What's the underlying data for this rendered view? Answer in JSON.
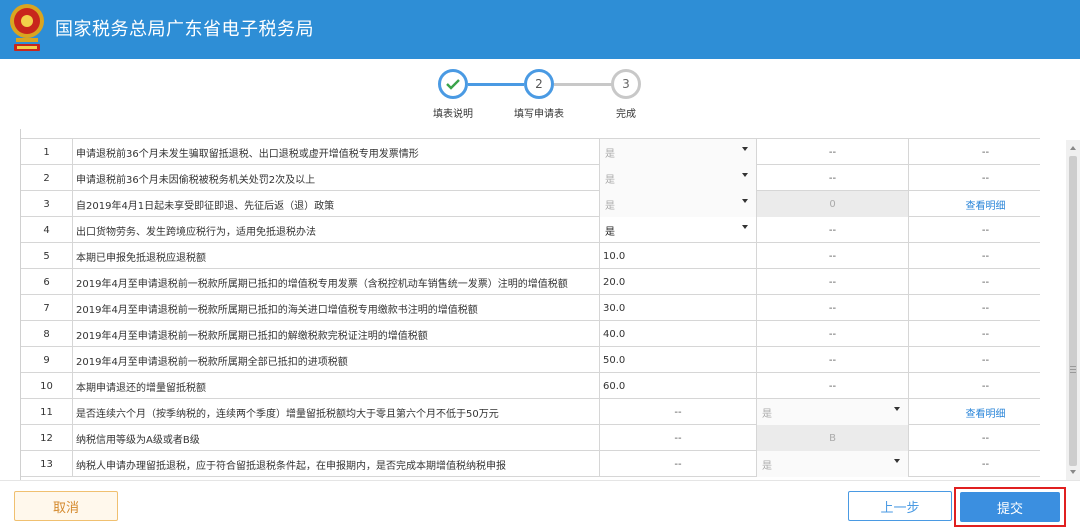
{
  "header": {
    "title": "国家税务总局广东省电子税务局",
    "background": "#2e8ed6"
  },
  "stepper": {
    "steps": [
      {
        "label": "填表说明",
        "state": "done",
        "icon": "check-icon"
      },
      {
        "label": "填写申请表",
        "state": "current",
        "number": "2"
      },
      {
        "label": "完成",
        "state": "pending",
        "number": "3"
      }
    ]
  },
  "table": {
    "rows": [
      {
        "no": "1",
        "desc": "申请退税前36个月未发生骗取留抵退税、出口退税或虚开增值税专用发票情形",
        "value": "是",
        "value_type": "select-disabled",
        "sub": "--",
        "action": "--"
      },
      {
        "no": "2",
        "desc": "申请退税前36个月未因偷税被税务机关处罚2次及以上",
        "value": "是",
        "value_type": "select-disabled",
        "sub": "--",
        "action": "--"
      },
      {
        "no": "3",
        "desc": "自2019年4月1日起未享受即征即退、先征后返（退）政策",
        "value": "是",
        "value_type": "select-disabled",
        "sub": "0",
        "sub_type": "grey",
        "action": "查看明细",
        "action_type": "link"
      },
      {
        "no": "4",
        "desc": "出口货物劳务、发生跨境应税行为，适用免抵退税办法",
        "value": "是",
        "value_type": "select",
        "sub": "--",
        "action": "--"
      },
      {
        "no": "5",
        "desc": "本期已申报免抵退税应退税额",
        "value": "10.0",
        "value_type": "text",
        "sub": "--",
        "action": "--"
      },
      {
        "no": "6",
        "desc": "2019年4月至申请退税前一税款所属期已抵扣的增值税专用发票（含税控机动车销售统一发票）注明的增值税额",
        "value": "20.0",
        "value_type": "text",
        "sub": "--",
        "action": "--"
      },
      {
        "no": "7",
        "desc": "2019年4月至申请退税前一税款所属期已抵扣的海关进口增值税专用缴款书注明的增值税额",
        "value": "30.0",
        "value_type": "text",
        "sub": "--",
        "action": "--"
      },
      {
        "no": "8",
        "desc": "2019年4月至申请退税前一税款所属期已抵扣的解缴税款完税证注明的增值税额",
        "value": "40.0",
        "value_type": "text",
        "sub": "--",
        "action": "--"
      },
      {
        "no": "9",
        "desc": "2019年4月至申请退税前一税款所属期全部已抵扣的进项税额",
        "value": "50.0",
        "value_type": "text",
        "sub": "--",
        "action": "--"
      },
      {
        "no": "10",
        "desc": "本期申请退还的增量留抵税额",
        "value": "60.0",
        "value_type": "text",
        "sub": "--",
        "action": "--"
      },
      {
        "no": "11",
        "desc": "是否连续六个月（按季纳税的，连续两个季度）增量留抵税额均大于零且第六个月不低于50万元",
        "value": "--",
        "value_type": "center",
        "sub": "是",
        "sub_type": "select-disabled",
        "action": "查看明细",
        "action_type": "link"
      },
      {
        "no": "12",
        "desc": "纳税信用等级为A级或者B级",
        "value": "--",
        "value_type": "center",
        "sub": "B",
        "sub_type": "grey",
        "action": "--"
      },
      {
        "no": "13",
        "desc": "纳税人申请办理留抵退税，应于符合留抵退税条件起，在申报期内，是否完成本期增值税纳税申报",
        "value": "--",
        "value_type": "center",
        "sub": "是",
        "sub_type": "select-disabled",
        "action": "--"
      }
    ]
  },
  "footer": {
    "cancel_label": "取消",
    "prev_label": "上一步",
    "submit_label": "提交"
  }
}
